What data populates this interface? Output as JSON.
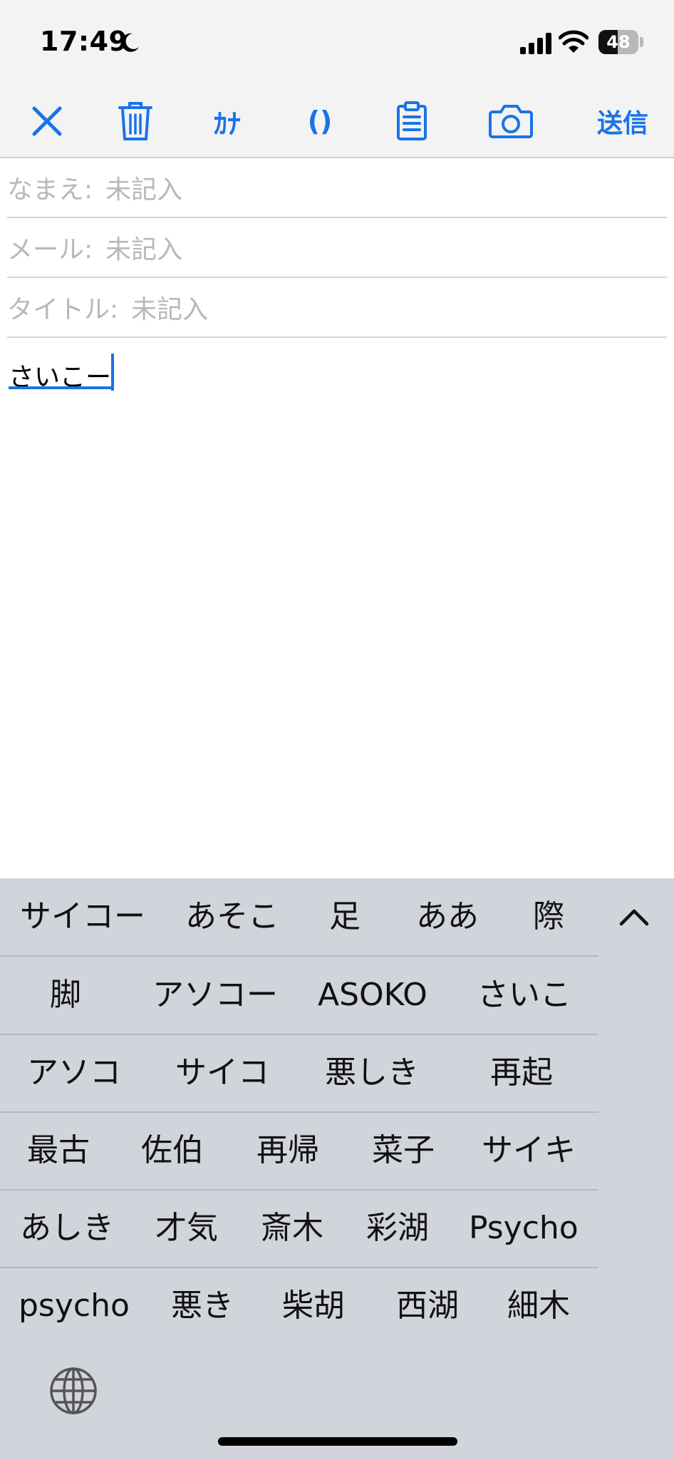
{
  "status_bar": {
    "time": "17:49",
    "battery": "48",
    "battery_level": 0.48
  },
  "toolbar": {
    "kana_label": "ｶﾅ",
    "paren_label": "()",
    "send_label": "送信"
  },
  "form": {
    "name_label": "なまえ:",
    "name_placeholder": "未記入",
    "mail_label": "メール:",
    "mail_placeholder": "未記入",
    "title_label": "タイトル:",
    "title_placeholder": "未記入",
    "body_text": "さいこー"
  },
  "keyboard": {
    "candidates": [
      [
        "サイコー",
        "あそこ",
        "足",
        "ああ",
        "際"
      ],
      [
        "脚",
        "アソコー",
        "ASOKO",
        "さいこ"
      ],
      [
        "アソコ",
        "サイコ",
        "悪しき",
        "再起"
      ],
      [
        "最古",
        "佐伯",
        "再帰",
        "菜子",
        "サイキ"
      ],
      [
        "あしき",
        "才気",
        "斎木",
        "彩湖",
        "Psycho"
      ],
      [
        "psycho",
        "悪き",
        "柴胡",
        "西湖",
        "細木"
      ]
    ]
  },
  "colors": {
    "accent": "#1a73e8",
    "keyboard_bg": "#d1d4da"
  }
}
